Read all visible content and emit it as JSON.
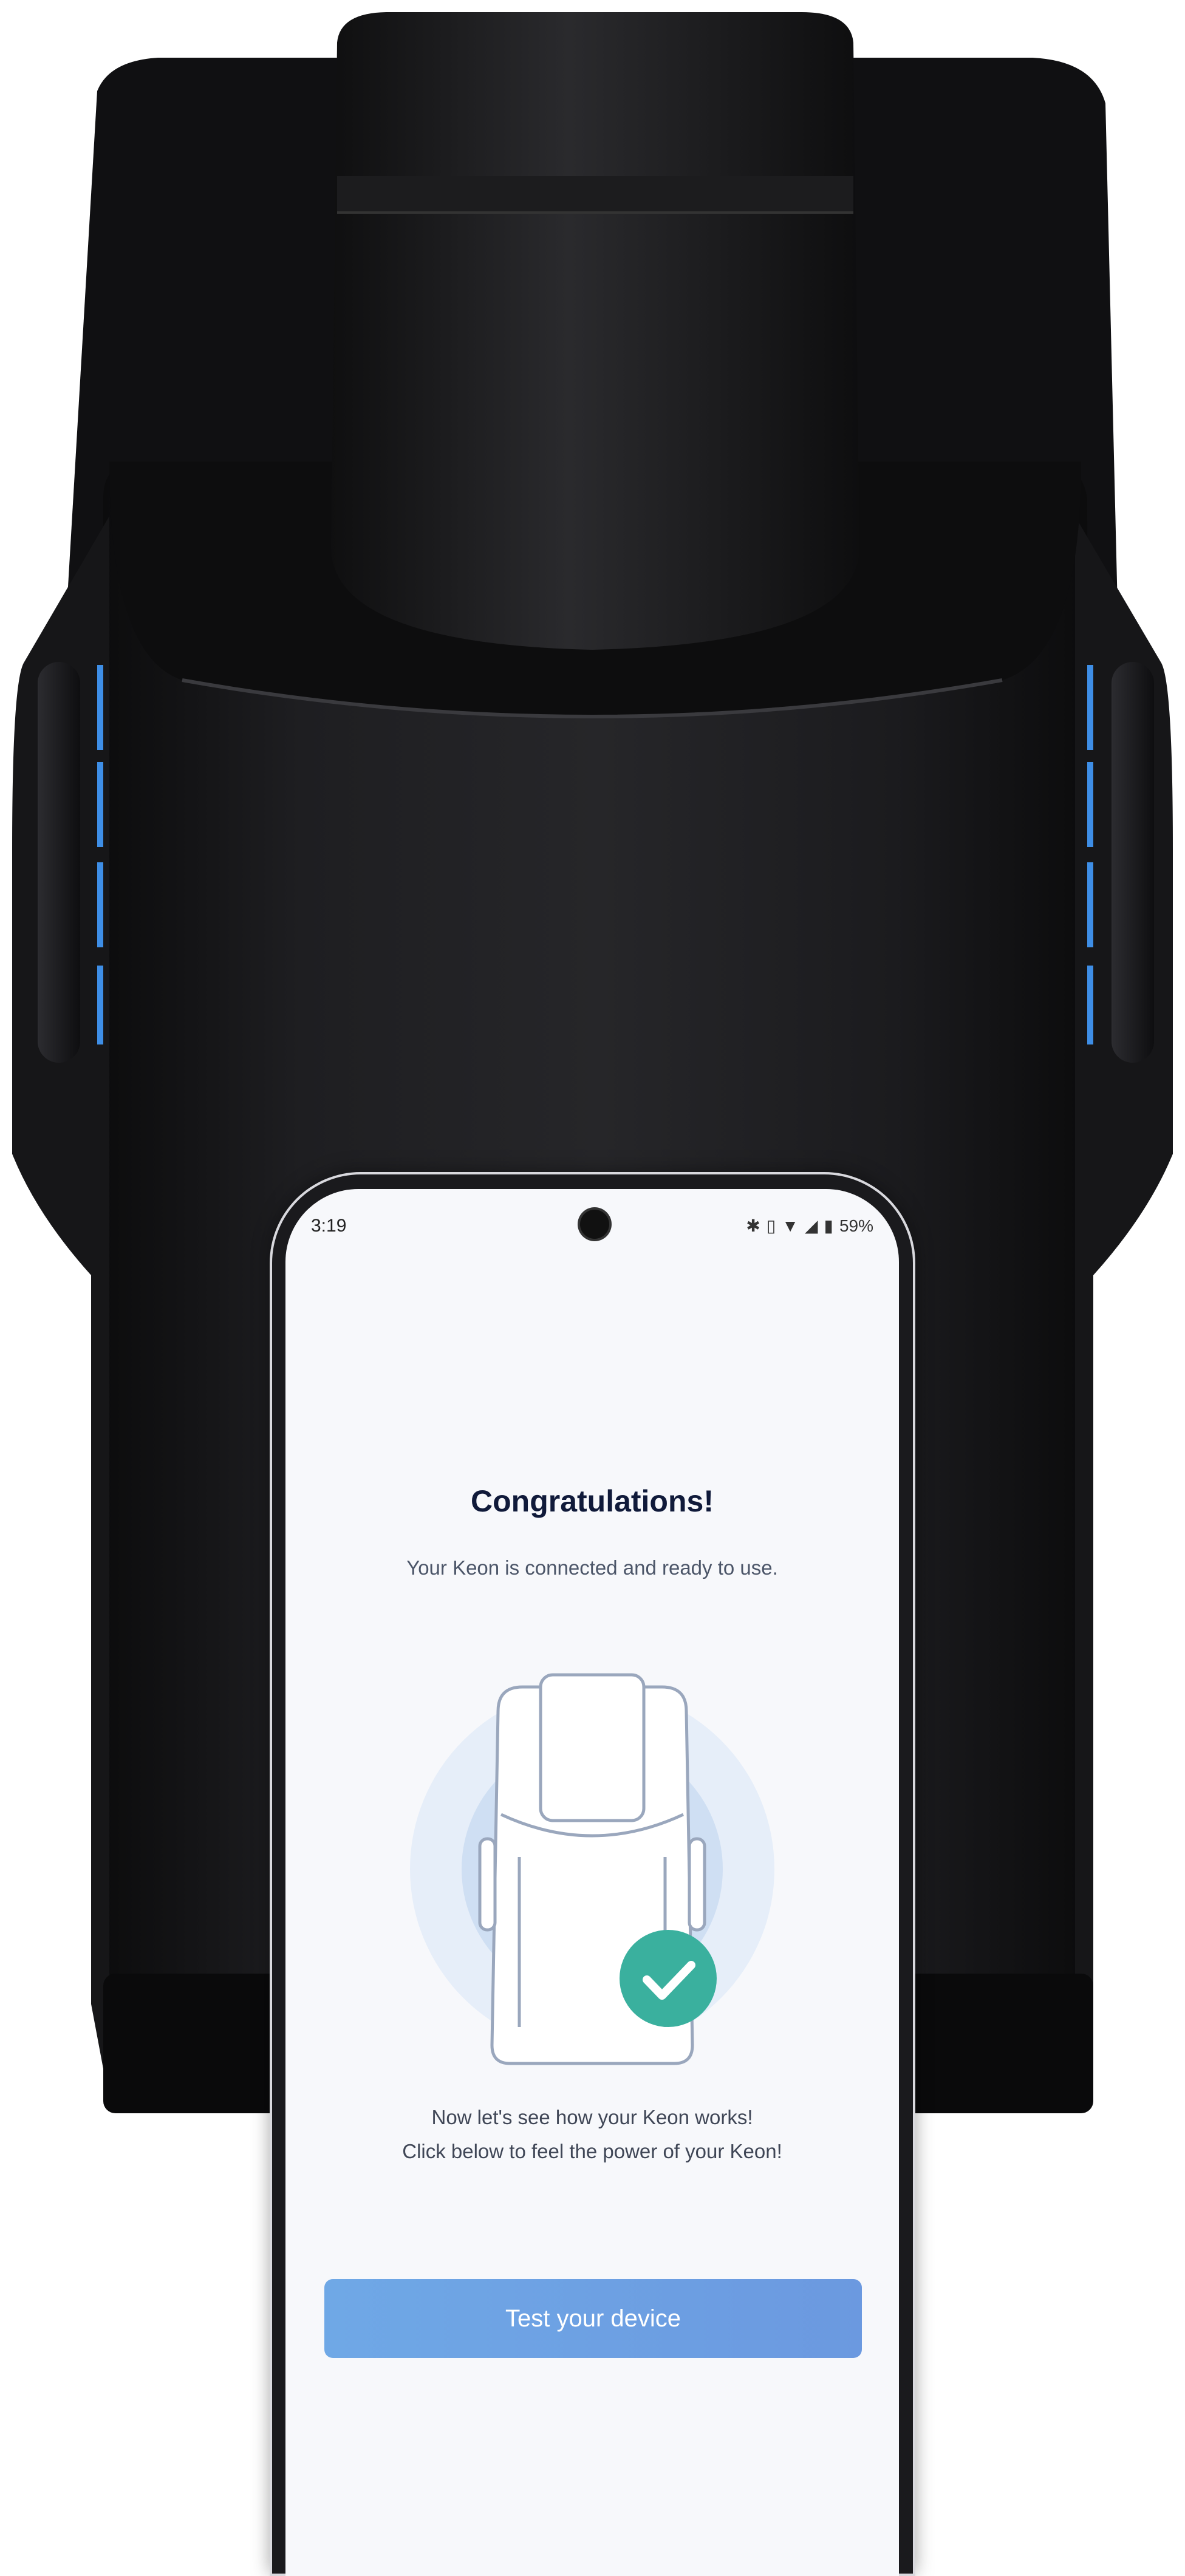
{
  "status_bar": {
    "time": "3:19",
    "battery": "59%",
    "icons": [
      "bluetooth-icon",
      "vibrate-icon",
      "wifi-icon",
      "signal-icon",
      "battery-icon"
    ]
  },
  "screen": {
    "title": "Congratulations!",
    "subtitle": "Your Keon is connected and ready to use.",
    "info_line_1": "Now let's see how your Keon works!",
    "info_line_2": "Click below to feel the power of your Keon!",
    "button_label": "Test your device"
  },
  "colors": {
    "device_body": "#141416",
    "accent_led": "#3e8ee6",
    "check_badge": "#3ab09e",
    "button": "#6fa8e6",
    "title": "#101a3a"
  }
}
